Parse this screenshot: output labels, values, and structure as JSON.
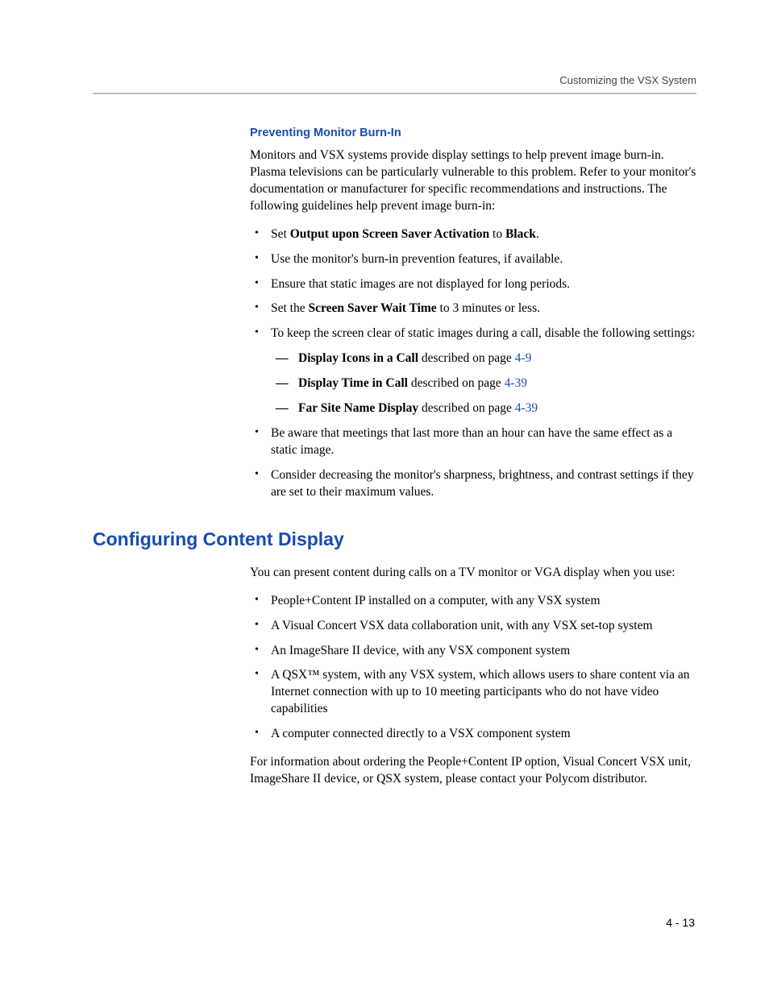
{
  "header": {
    "right": "Customizing the VSX System"
  },
  "section1": {
    "heading": "Preventing Monitor Burn-In",
    "p1": "Monitors and VSX systems provide display settings to help prevent image burn-in. Plasma televisions can be particularly vulnerable to this problem. Refer to your monitor's documentation or manufacturer for specific recommendations and instructions. The following guidelines help prevent image burn-in:",
    "b1": {
      "pre": "Set ",
      "bold1": "Output upon Screen Saver Activation",
      "mid": " to ",
      "bold2": "Black",
      "post": "."
    },
    "b2": "Use the monitor's burn-in prevention features, if available.",
    "b3": "Ensure that static images are not displayed for long periods.",
    "b4": {
      "pre": "Set the ",
      "bold": "Screen Saver Wait Time",
      "post": " to 3 minutes or less."
    },
    "b5": "To keep the screen clear of static images during a call, disable the following settings:",
    "d1": {
      "bold": "Display Icons in a Call",
      "text": " described on page ",
      "link": "4-9"
    },
    "d2": {
      "bold": "Display Time in Call",
      "text": " described on page ",
      "link": "4-39"
    },
    "d3": {
      "bold": "Far Site Name Display",
      "text": " described on page ",
      "link": "4-39"
    },
    "b6": "Be aware that meetings that last more than an hour can have the same effect as a static image.",
    "b7": "Consider decreasing the monitor's sharpness, brightness, and contrast settings if they are set to their maximum values."
  },
  "section2": {
    "heading": "Configuring Content Display",
    "p1": "You can present content during calls on a TV monitor or VGA display when you use:",
    "b1": "People+Content IP installed on a computer, with any VSX system",
    "b2": "A Visual Concert VSX data collaboration unit, with any VSX set-top system",
    "b3": "An ImageShare II device, with any VSX component system",
    "b4": "A QSX™ system, with any VSX system, which allows users to share content via an Internet connection with up to 10 meeting participants who do not have video capabilities",
    "b5": "A computer connected directly to a VSX component system",
    "p2": "For information about ordering the People+Content IP option, Visual Concert VSX unit, ImageShare II device, or QSX system, please contact your Polycom distributor."
  },
  "footer": {
    "pagenum": "4 - 13"
  }
}
